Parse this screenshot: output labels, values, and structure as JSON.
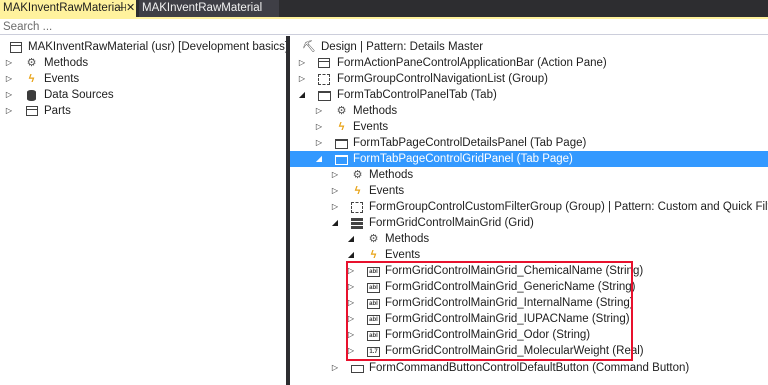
{
  "tabs": {
    "active_label": "MAKInventRawMaterial",
    "pin_glyph": "⊣",
    "close_glyph": "✕",
    "inactive_label": "MAKInventRawMaterial"
  },
  "search": {
    "placeholder": "Search ..."
  },
  "left_tree": {
    "root_label": "MAKInventRawMaterial (usr) [Development basics]",
    "items": [
      {
        "label": "Methods",
        "icon": "methods-icon"
      },
      {
        "label": "Events",
        "icon": "events-icon"
      },
      {
        "label": "Data Sources",
        "icon": "datasource-icon"
      },
      {
        "label": "Parts",
        "icon": "parts-icon"
      }
    ]
  },
  "right_tree": {
    "root_label": "Design | Pattern: Details Master",
    "action_pane": "FormActionPaneControlApplicationBar (Action Pane)",
    "nav_list": "FormGroupControlNavigationList (Group)",
    "tab": "FormTabControlPanelTab (Tab)",
    "tab_methods": "Methods",
    "tab_events": "Events",
    "details_panel": "FormTabPageControlDetailsPanel (Tab Page)",
    "grid_panel": "FormTabPageControlGridPanel (Tab Page)",
    "grid_panel_methods": "Methods",
    "grid_panel_events": "Events",
    "custom_filter": "FormGroupControlCustomFilterGroup (Group) | Pattern: Custom and Quick Filters",
    "main_grid": "FormGridControlMainGrid (Grid)",
    "grid_methods": "Methods",
    "grid_events": "Events",
    "grid_fields": [
      {
        "label": "FormGridControlMainGrid_ChemicalName (String)",
        "badge": "abl"
      },
      {
        "label": "FormGridControlMainGrid_GenericName (String)",
        "badge": "abl"
      },
      {
        "label": "FormGridControlMainGrid_InternalName (String)",
        "badge": "abl"
      },
      {
        "label": "FormGridControlMainGrid_IUPACName (String)",
        "badge": "abl"
      },
      {
        "label": "FormGridControlMainGrid_Odor (String)",
        "badge": "abl"
      },
      {
        "label": "FormGridControlMainGrid_MolecularWeight (Real)",
        "badge": "1.7"
      }
    ],
    "default_button": "FormCommandButtonControlDefaultButton (Command Button)"
  },
  "colors": {
    "active_tab": "#fff29d",
    "selection": "#3399ff",
    "highlight_border": "#e8112d",
    "chrome": "#2d2d30"
  }
}
